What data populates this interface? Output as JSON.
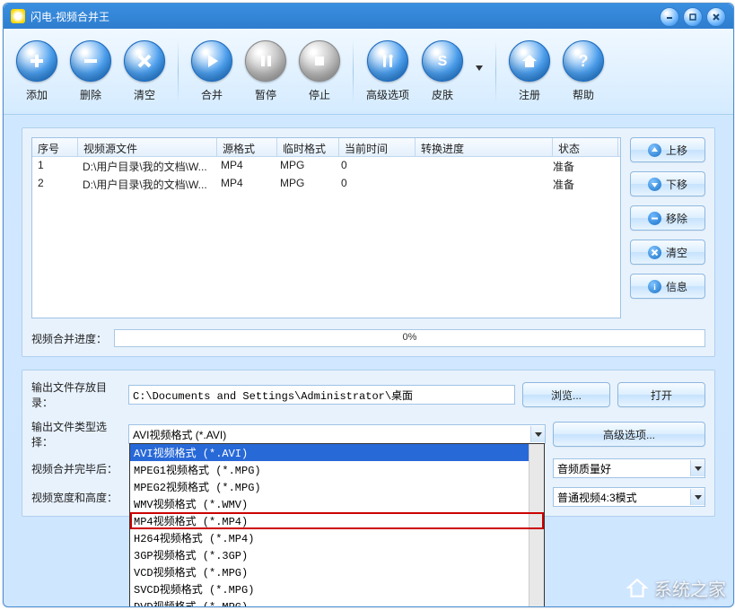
{
  "title": "闪电-视频合并王",
  "toolbar": {
    "add": "添加",
    "del": "删除",
    "clear": "清空",
    "merge": "合并",
    "pause": "暂停",
    "stop": "停止",
    "adv": "高级选项",
    "skin": "皮肤",
    "register": "注册",
    "help": "帮助"
  },
  "list": {
    "headers": {
      "seq": "序号",
      "src": "视频源文件",
      "srcfmt": "源格式",
      "tmpfmt": "临时格式",
      "time": "当前时间",
      "progress": "转换进度",
      "state": "状态"
    },
    "rows": [
      {
        "seq": "1",
        "src": "D:\\用户目录\\我的文档\\W...",
        "srcfmt": "MP4",
        "tmpfmt": "MPG",
        "time": "0",
        "progress": "",
        "state": "准备"
      },
      {
        "seq": "2",
        "src": "D:\\用户目录\\我的文档\\W...",
        "srcfmt": "MP4",
        "tmpfmt": "MPG",
        "time": "0",
        "progress": "",
        "state": "准备"
      }
    ]
  },
  "side": {
    "up": "上移",
    "down": "下移",
    "remove": "移除",
    "clear": "清空",
    "info": "信息"
  },
  "progress": {
    "label": "视频合并进度：",
    "pct": "0%"
  },
  "output": {
    "dir_label": "输出文件存放目录：",
    "dir_value": "C:\\Documents and Settings\\Administrator\\桌面",
    "browse": "浏览...",
    "open": "打开",
    "type_label": "输出文件类型选择：",
    "type_value": "AVI视频格式 (*.AVI)",
    "adv_btn": "高级选项...",
    "after_label": "视频合并完毕后：",
    "quality_value": "音频质量好",
    "size_label": "视频宽度和高度：",
    "aspect_value": "普通视频4:3模式"
  },
  "formats": [
    "AVI视频格式 (*.AVI)",
    "MPEG1视频格式 (*.MPG)",
    "MPEG2视频格式 (*.MPG)",
    "WMV视频格式 (*.WMV)",
    "MP4视频格式 (*.MP4)",
    "H264视频格式 (*.MP4)",
    "3GP视频格式 (*.3GP)",
    "VCD视频格式 (*.MPG)",
    "SVCD视频格式 (*.MPG)",
    "DVD视频格式 (*.MPG)"
  ],
  "watermark": "系统之家"
}
